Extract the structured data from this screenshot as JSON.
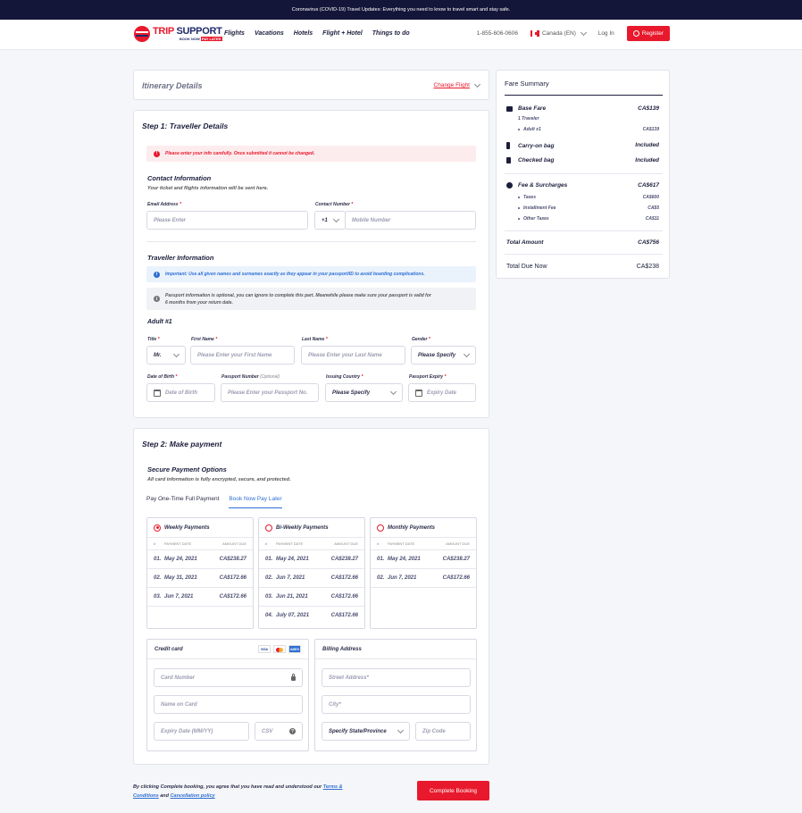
{
  "topbar": {
    "text": "Coronavirus (COVID-19) Travel Updates: Everything you need to know to travel smart and stay safe."
  },
  "brand": {
    "name_red": "TRIP",
    "name_blue": "SUPPORT",
    "tagline": "BOOK NOW",
    "tagline_badge": "PAY LATER"
  },
  "nav": {
    "menu": [
      "Flights",
      "Vacations",
      "Hotels",
      "Flight + Hotel",
      "Things to do"
    ],
    "phone": "1-855-606-0606",
    "locale": "Canada (EN)",
    "login": "Log In",
    "register": "Register"
  },
  "itinerary": {
    "title": "Itinerary Details",
    "change": "Change Flight"
  },
  "step1": {
    "title": "Step 1:  Traveller Details",
    "alert": "Please enter your info carefully. Once submitted it cannot be changed.",
    "contact": {
      "title": "Contact Information",
      "subtitle": "Your ticket and flights information will be sent here.",
      "email_label": "Email Address",
      "email_placeholder": "Please Enter",
      "phone_label": "Contact Number",
      "phone_code": "+1",
      "phone_placeholder": "Mobile Number"
    },
    "traveller": {
      "title": "Traveller Information",
      "important": "Important: Use all given names and surnames exactly as they appear in your passport/ID to avoid boarding complications.",
      "passport_note_1": "Passport information is optional, you can ignore to complete this part. Meanwhile please make sure your passport is valid for",
      "passport_note_2": "6 months from your return date.",
      "adult": "Adult #1",
      "title_label": "Title",
      "title_value": "Mr.",
      "first_label": "First Name",
      "first_placeholder": "Please Enter your First Name",
      "last_label": "Last Name",
      "last_placeholder": "Please Enter your Last Name",
      "gender_label": "Gender",
      "gender_value": "Please Specify",
      "dob_label": "Date of Birth",
      "dob_placeholder": "Date of Birth",
      "passport_label": "Passport Number",
      "passport_optional": "(Optional)",
      "passport_placeholder": "Please Enter your Passport No.",
      "country_label": "Issuing Country",
      "country_value": "Please Specify",
      "expiry_label": "Passport Expiry",
      "expiry_placeholder": "Expiry Date",
      "required_mark": "*"
    }
  },
  "step2": {
    "title": "Step 2:  Make payment",
    "secure_title": "Secure Payment Options",
    "secure_sub": "All card information is fully encrypted, secure, and protected.",
    "tabs": [
      "Pay One-Time Full Payment",
      "Book Now Pay Later"
    ],
    "col_headers": [
      "#",
      "PAYMENT DATE",
      "AMOUNT DUE"
    ],
    "plans": [
      {
        "name": "Weekly Payments",
        "rows": [
          [
            "01.",
            "May 24, 2021",
            "CA$238.27"
          ],
          [
            "02.",
            "May 31, 2021",
            "CA$172.66"
          ],
          [
            "03.",
            "Jun 7, 2021",
            "CA$172.66"
          ]
        ]
      },
      {
        "name": "Bi-Weekly Payments",
        "rows": [
          [
            "01.",
            "May 24, 2021",
            "CA$238.27"
          ],
          [
            "02.",
            "Jun 7, 2021",
            "CA$172.66"
          ],
          [
            "03.",
            "Jun 21, 2021",
            "CA$172.66"
          ],
          [
            "04.",
            "July 07, 2021",
            "CA$172.66"
          ]
        ]
      },
      {
        "name": "Monthly Payments",
        "rows": [
          [
            "01.",
            "May 24, 2021",
            "CA$238.27"
          ],
          [
            "02.",
            "Jun 7, 2021",
            "CA$172.66"
          ]
        ]
      }
    ],
    "credit": {
      "title": "Credit card",
      "card_brands": [
        "VISA",
        "",
        "AMEX"
      ],
      "card_number": "Card Number",
      "name_on_card": "Name on Card",
      "expiry": "Expiry Date (MM/YY)",
      "csv": "CSV",
      "help": "?"
    },
    "billing": {
      "title": "Billing Address",
      "street": "Street Address*",
      "city": "City*",
      "state": "Specify State/Province",
      "zip": "Zip Code"
    }
  },
  "footer": {
    "text_1": "By clicking Complete booking, you agree that you have read and understood our",
    "terms": "Terms &",
    "conditions": "Conditions",
    "and": "and",
    "cancellation": "Cancellation policy",
    "button": "Complete Booking"
  },
  "fare": {
    "title": "Fare Summary",
    "base_fare": "Base Fare",
    "base_fare_value": "CA$139",
    "travelers": "1 Traveler",
    "adult": "Adult x1",
    "adult_value": "CA$139",
    "carry_on": "Carry-on bag",
    "carry_on_value": "Included",
    "checked": "Checked bag",
    "checked_value": "Included",
    "fees": "Fee & Surcharges",
    "fees_value": "CA$617",
    "taxes": "Taxes",
    "taxes_value": "CA$600",
    "installment": "Installment Fee",
    "installment_value": "CA$5",
    "other": "Other Taxes",
    "other_value": "CA$11",
    "total": "Total Amount",
    "total_value": "CA$756",
    "due": "Total Due Now",
    "due_value": "CA$238"
  },
  "colors": {
    "accent": "#e8192c",
    "link": "#2f6fd3",
    "topbar": "#131638"
  }
}
